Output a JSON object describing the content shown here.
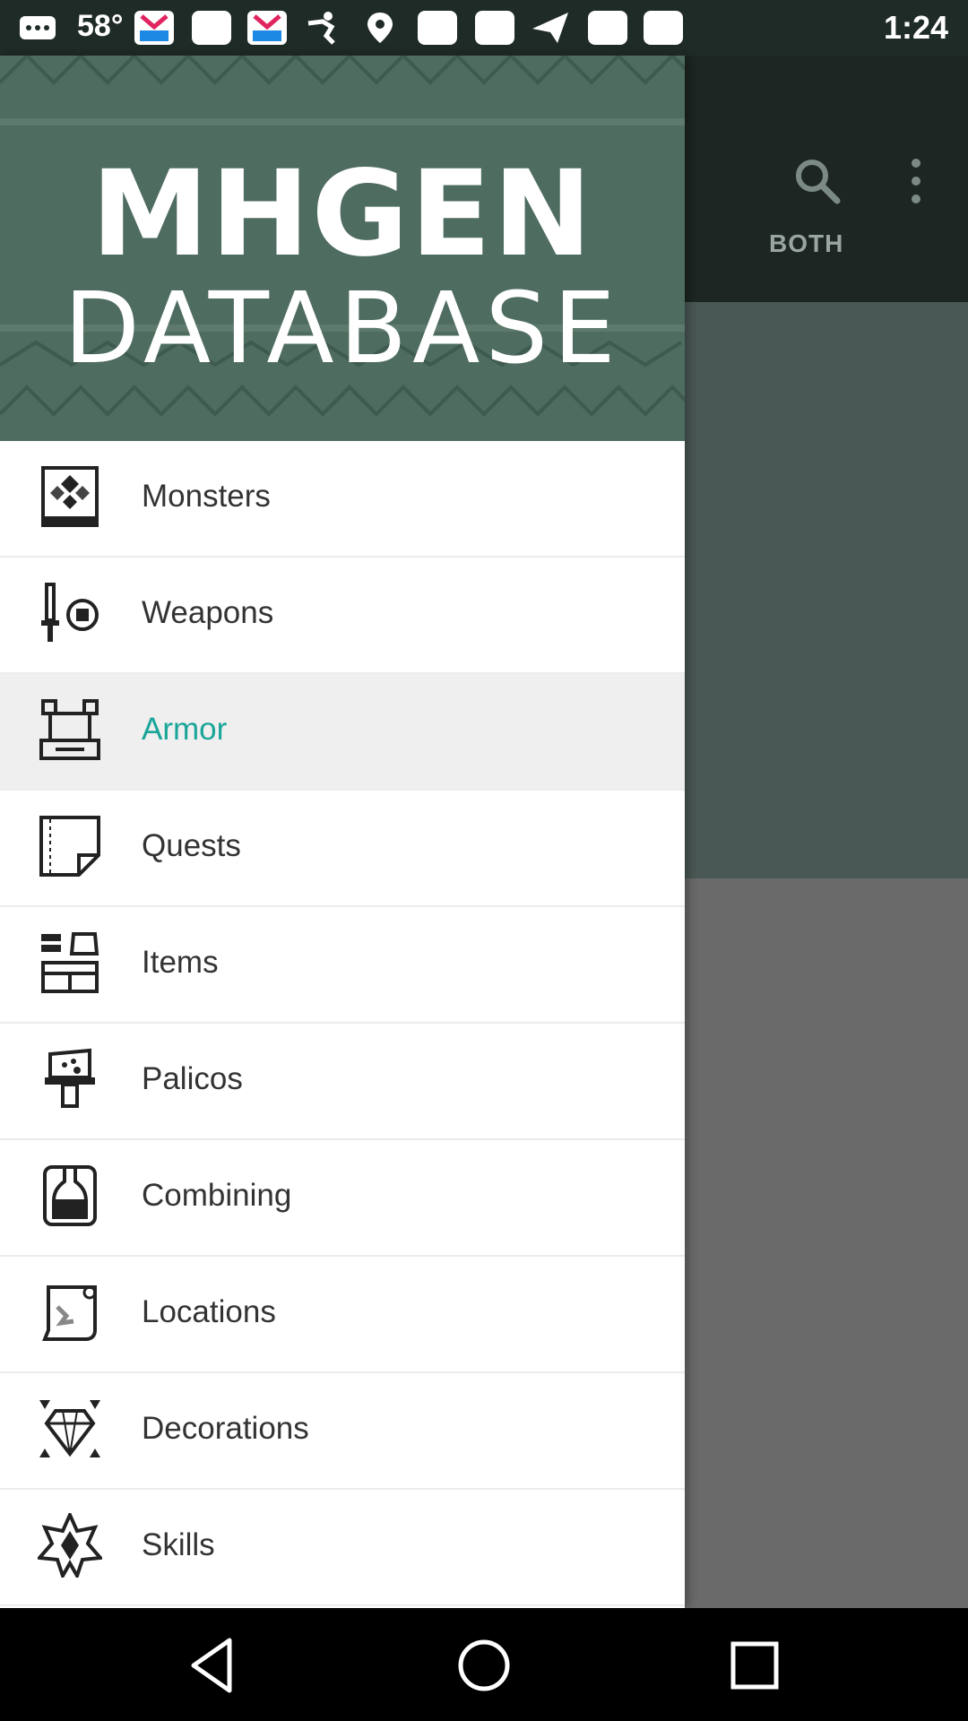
{
  "status_bar": {
    "temperature": "58°",
    "time": "1:24",
    "icons": [
      "messages-icon",
      "pop-app-icon",
      "square-icon",
      "pop-app-icon",
      "person-icon",
      "location-pin-icon",
      "square-icon",
      "square-icon",
      "send-icon",
      "square-icon",
      "square-icon"
    ]
  },
  "app_bar": {
    "tab_label": "BOTH",
    "search_icon": "search-icon",
    "more_icon": "more-vert-icon"
  },
  "drawer": {
    "header": {
      "title_line1": "MHGEN",
      "title_line2": "DATABASE"
    },
    "items": [
      {
        "label": "Monsters",
        "icon": "monster-book-icon",
        "selected": false
      },
      {
        "label": "Weapons",
        "icon": "sword-shield-icon",
        "selected": false
      },
      {
        "label": "Armor",
        "icon": "armor-icon",
        "selected": true
      },
      {
        "label": "Quests",
        "icon": "quest-scroll-icon",
        "selected": false
      },
      {
        "label": "Items",
        "icon": "items-icon",
        "selected": false
      },
      {
        "label": "Palicos",
        "icon": "palico-icon",
        "selected": false
      },
      {
        "label": "Combining",
        "icon": "potion-icon",
        "selected": false
      },
      {
        "label": "Locations",
        "icon": "map-icon",
        "selected": false
      },
      {
        "label": "Decorations",
        "icon": "jewel-icon",
        "selected": false
      },
      {
        "label": "Skills",
        "icon": "skill-star-icon",
        "selected": false
      }
    ],
    "selected_color": "#1aa59a"
  },
  "nav_bar": {
    "back_icon": "back-icon",
    "home_icon": "home-icon",
    "recents_icon": "recents-icon"
  }
}
